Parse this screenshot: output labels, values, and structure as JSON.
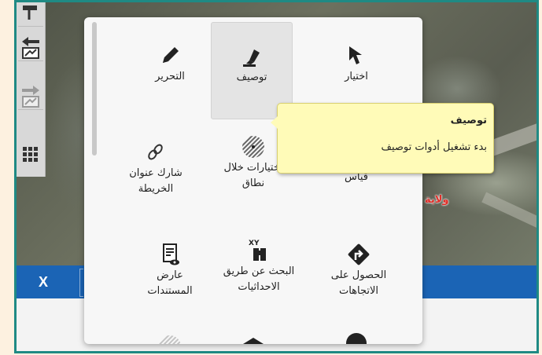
{
  "map": {
    "label": "ولاية"
  },
  "bottom_bar": {
    "close_label": "X"
  },
  "tools": [
    {
      "id": "edit",
      "label": "التحرير",
      "icon": "pencil-icon"
    },
    {
      "id": "describe",
      "label": "توصيف",
      "icon": "marker-icon",
      "active": true
    },
    {
      "id": "select",
      "label": "اختيار",
      "icon": "cursor-arrow-icon"
    },
    {
      "id": "share",
      "label": "شارك عنوان الخريطة",
      "icon": "link-icon"
    },
    {
      "id": "range",
      "label": "إختيارات خلال نطاق",
      "icon": "radius-select-icon"
    },
    {
      "id": "measure",
      "label": "قياس",
      "icon": "ruler-icon"
    },
    {
      "id": "doc-viewer",
      "label": "عارض المستندات",
      "icon": "document-viewer-icon"
    },
    {
      "id": "xy-search",
      "label": "البحث عن طريق الاحداثيات",
      "icon": "xy-binoculars-icon"
    },
    {
      "id": "directions",
      "label": "الحصول على الاتجاهات",
      "icon": "directions-icon"
    }
  ],
  "tooltip": {
    "title": "توصيف",
    "body": "بدء تشغيل أدوات توصيف"
  }
}
